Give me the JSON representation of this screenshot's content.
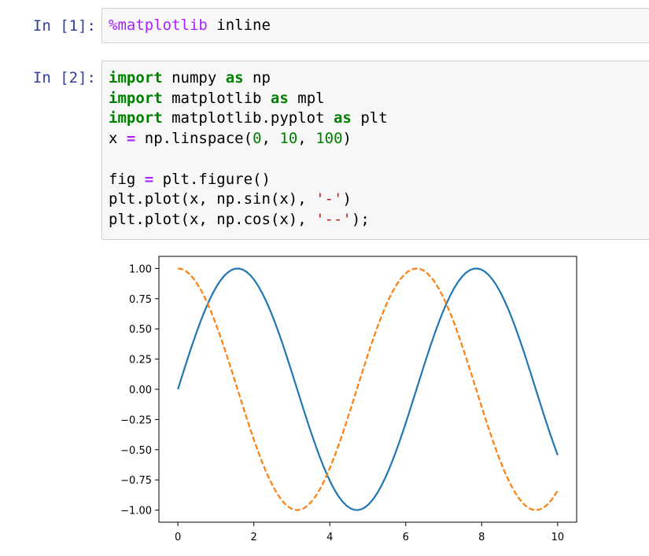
{
  "cells": [
    {
      "prompt": "In [1]:",
      "lines": [
        [
          {
            "t": "%matplotlib",
            "c": "magic"
          },
          {
            "t": " inline",
            "c": ""
          }
        ]
      ]
    },
    {
      "prompt": "In [2]:",
      "lines": [
        [
          {
            "t": "import",
            "c": "kw"
          },
          {
            "t": " numpy ",
            "c": ""
          },
          {
            "t": "as",
            "c": "kw"
          },
          {
            "t": " np",
            "c": ""
          }
        ],
        [
          {
            "t": "import",
            "c": "kw"
          },
          {
            "t": " matplotlib ",
            "c": ""
          },
          {
            "t": "as",
            "c": "kw"
          },
          {
            "t": " mpl",
            "c": ""
          }
        ],
        [
          {
            "t": "import",
            "c": "kw"
          },
          {
            "t": " matplotlib.pyplot ",
            "c": ""
          },
          {
            "t": "as",
            "c": "kw"
          },
          {
            "t": " plt",
            "c": ""
          }
        ],
        [
          {
            "t": "x ",
            "c": ""
          },
          {
            "t": "=",
            "c": "op"
          },
          {
            "t": " np.linspace(",
            "c": ""
          },
          {
            "t": "0",
            "c": "num"
          },
          {
            "t": ", ",
            "c": ""
          },
          {
            "t": "10",
            "c": "num"
          },
          {
            "t": ", ",
            "c": ""
          },
          {
            "t": "100",
            "c": "num"
          },
          {
            "t": ")",
            "c": ""
          }
        ],
        [],
        [
          {
            "t": "fig ",
            "c": ""
          },
          {
            "t": "=",
            "c": "op"
          },
          {
            "t": " plt.figure()",
            "c": ""
          }
        ],
        [
          {
            "t": "plt.plot(x, np.sin(x), ",
            "c": ""
          },
          {
            "t": "'-'",
            "c": "str"
          },
          {
            "t": ")",
            "c": ""
          }
        ],
        [
          {
            "t": "plt.plot(x, np.cos(x), ",
            "c": ""
          },
          {
            "t": "'--'",
            "c": "str"
          },
          {
            "t": ");",
            "c": ""
          }
        ]
      ]
    }
  ],
  "chart_data": {
    "type": "line",
    "xlim": [
      -0.5,
      10.5
    ],
    "ylim": [
      -1.1,
      1.1
    ],
    "xticks": [
      "0",
      "2",
      "4",
      "6",
      "8",
      "10"
    ],
    "yticks": [
      "1.00",
      "0.75",
      "0.50",
      "0.25",
      "0.00",
      "−0.25",
      "−0.50",
      "−0.75",
      "−1.00"
    ],
    "series": [
      {
        "function": "sin",
        "style": "solid",
        "color": "#1f77b4",
        "x_range": [
          0,
          10
        ],
        "n_points": 100
      },
      {
        "function": "cos",
        "style": "dashed",
        "color": "#ff7f0e",
        "x_range": [
          0,
          10
        ],
        "n_points": 100
      }
    ],
    "grid": false
  }
}
